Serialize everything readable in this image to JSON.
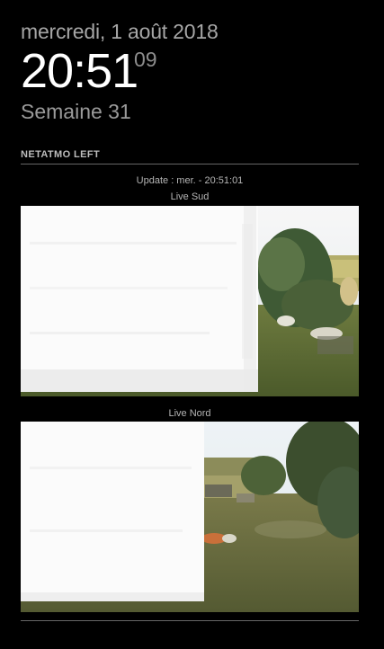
{
  "clock": {
    "date": "mercredi, 1 août 2018",
    "time": "20:51",
    "seconds": "09",
    "week": "Semaine 31"
  },
  "module": {
    "header": "NETATMO LEFT",
    "update": "Update : mer. - 20:51:01",
    "cameras": [
      {
        "label": "Live Sud"
      },
      {
        "label": "Live Nord"
      }
    ]
  }
}
